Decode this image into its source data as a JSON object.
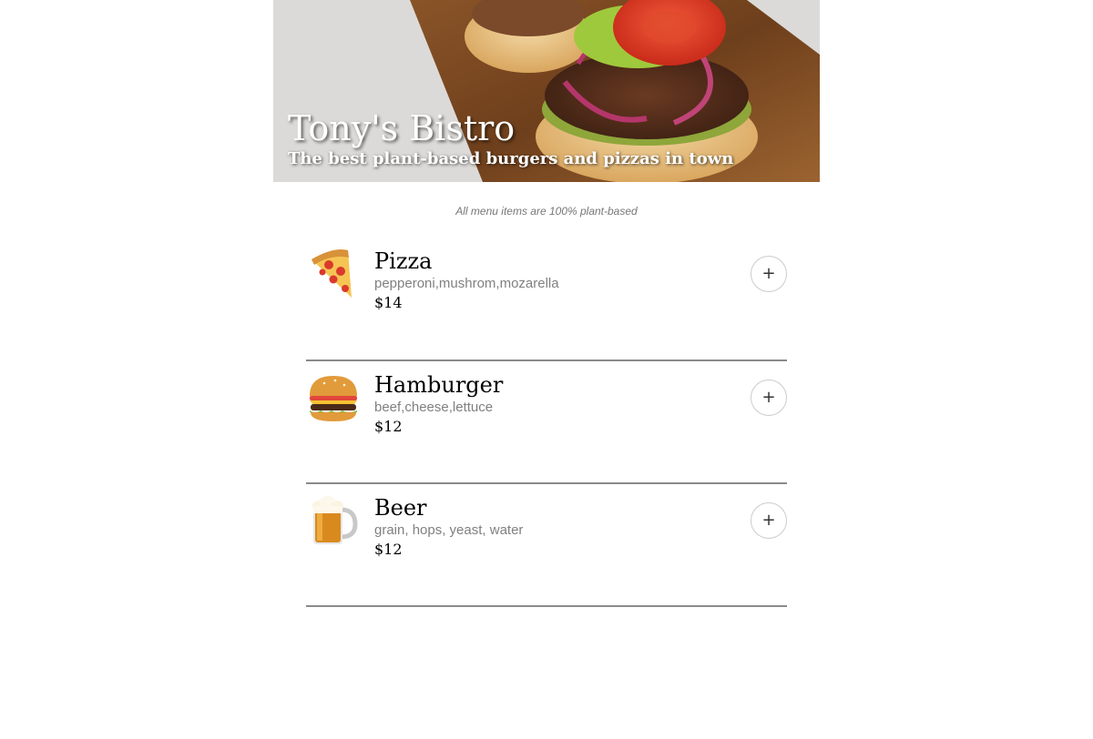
{
  "header": {
    "title": "Tony's Bistro",
    "subtitle": "The best plant-based burgers and pizzas in town"
  },
  "note": "All menu items are 100% plant-based",
  "menu": {
    "items": [
      {
        "icon": "pizza-icon",
        "name": "Pizza",
        "ingredients": "pepperoni,mushrom,mozarella",
        "price": "$14",
        "add_label": "+"
      },
      {
        "icon": "hamburger-icon",
        "name": "Hamburger",
        "ingredients": "beef,cheese,lettuce",
        "price": "$12",
        "add_label": "+"
      },
      {
        "icon": "beer-icon",
        "name": "Beer",
        "ingredients": "grain, hops, yeast, water",
        "price": "$12",
        "add_label": "+"
      }
    ]
  },
  "colors": {
    "divider": "#8a8a8a",
    "muted_text": "#808080",
    "button_border": "#cccccc"
  }
}
